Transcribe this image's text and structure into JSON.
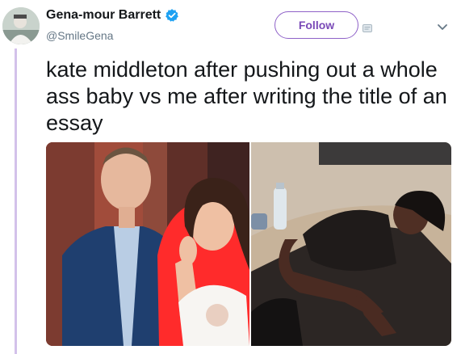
{
  "author": {
    "display_name": "Gena-mour Barrett",
    "handle": "@SmileGena",
    "verified": true
  },
  "actions": {
    "follow_label": "Follow",
    "more_icon": "chevron-down-icon",
    "extra_icon": "card-icon"
  },
  "tweet": {
    "text": "kate middleton after pushing out a whole ass baby vs me after writing the title of an essay"
  },
  "colors": {
    "accent": "#7a4ab7",
    "thread_line": "#d3c1ea",
    "verified": "#1da1f2",
    "handle": "#657786"
  }
}
